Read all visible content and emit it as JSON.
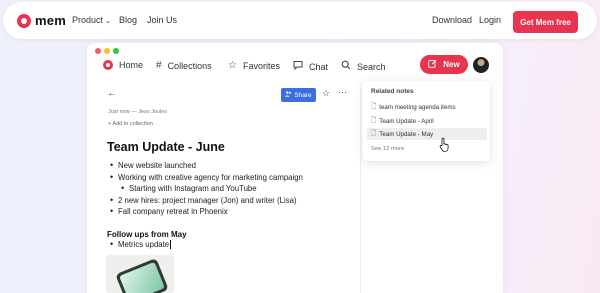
{
  "site": {
    "logo_text": "mem",
    "nav": [
      {
        "label": "Product",
        "chevron": "⌄"
      },
      {
        "label": "Blog"
      },
      {
        "label": "Join Us"
      }
    ],
    "right_links": [
      "Download",
      "Login"
    ],
    "cta_label": "Get Mem free",
    "brand_color": "#e8344f"
  },
  "app": {
    "window_dots": [
      "#f35f56",
      "#fbbd2e",
      "#2bc840"
    ],
    "tabs": [
      {
        "label": "Home",
        "icon": "home-logo-icon"
      },
      {
        "label": "Collections",
        "icon": "hash-icon"
      },
      {
        "label": "Favorites",
        "icon": "star-icon"
      },
      {
        "label": "Chat",
        "icon": "chat-icon"
      },
      {
        "label": "Search",
        "icon": "search-icon"
      }
    ],
    "new_button_label": "New",
    "toolbar": {
      "share_label": "Share"
    },
    "note": {
      "meta": "Just now — Jess Joules",
      "add_collection": "+ Add to collection",
      "title": "Team Update - June",
      "bullets": [
        {
          "text": "New website launched",
          "level": 0
        },
        {
          "text": "Working with creative agency for marketing campaign",
          "level": 0
        },
        {
          "text": "Starting with Instagram and YouTube",
          "level": 1
        },
        {
          "text": "2 new hires: project manager (Jon) and writer (Lisa)",
          "level": 0
        },
        {
          "text": "Fall company retreat in Phoenix",
          "level": 0
        }
      ],
      "subheading": "Follow ups from May",
      "sub_bullets": [
        "Metrics update"
      ]
    },
    "related": {
      "heading": "Related notes",
      "items": [
        "team meeting agenda items",
        "Team Update - April",
        "Team Update - May"
      ],
      "active_index": 2,
      "see_more": "See 12 more"
    }
  }
}
